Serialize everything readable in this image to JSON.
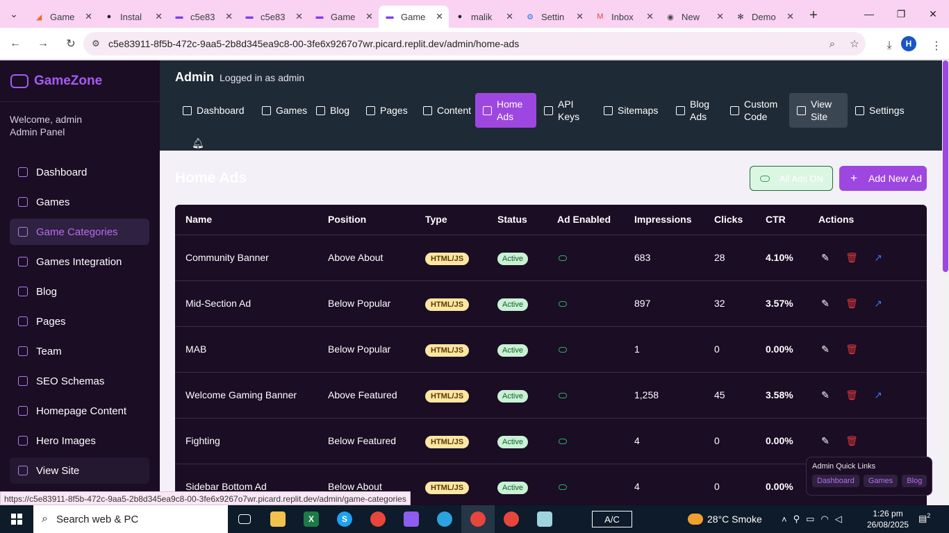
{
  "browser": {
    "tabs": [
      {
        "label": "Game",
        "icon": "orange"
      },
      {
        "label": "Instal",
        "icon": "github"
      },
      {
        "label": "c5e83",
        "icon": "gamepad"
      },
      {
        "label": "c5e83",
        "icon": "gamepad"
      },
      {
        "label": "Game",
        "icon": "gamepad"
      },
      {
        "label": "Game",
        "icon": "gamepad",
        "active": true
      },
      {
        "label": "malik",
        "icon": "github"
      },
      {
        "label": "Settin",
        "icon": "gear"
      },
      {
        "label": "Inbox",
        "icon": "gmail"
      },
      {
        "label": "New",
        "icon": "chrome"
      },
      {
        "label": "Demo",
        "icon": "openai"
      }
    ],
    "url": "c5e83911-8f5b-472c-9aa5-2b8d345ea9c8-00-3fe6x9267o7wr.picard.replit.dev/admin/home-ads",
    "profile_initial": "H",
    "status_url": "https://c5e83911-8f5b-472c-9aa5-2b8d345ea9c8-00-3fe6x9267o7wr.picard.replit.dev/admin/game-categories"
  },
  "sidebar": {
    "brand": "GameZone",
    "welcome": "Welcome, admin",
    "panel": "Admin Panel",
    "items": [
      {
        "label": "Dashboard"
      },
      {
        "label": "Games"
      },
      {
        "label": "Game Categories"
      },
      {
        "label": "Games Integration"
      },
      {
        "label": "Blog"
      },
      {
        "label": "Pages"
      },
      {
        "label": "Team"
      },
      {
        "label": "SEO Schemas"
      },
      {
        "label": "Homepage Content"
      },
      {
        "label": "Hero Images"
      },
      {
        "label": "View Site"
      }
    ]
  },
  "topbar": {
    "title": "Admin",
    "subtitle": "Logged in as admin",
    "tabs": [
      {
        "label": "Dashboard"
      },
      {
        "label": "Games"
      },
      {
        "label": "Blog"
      },
      {
        "label": "Pages"
      },
      {
        "label": "Content"
      },
      {
        "label": "Home Ads"
      },
      {
        "label": "API Keys"
      },
      {
        "label": "Sitemaps"
      },
      {
        "label": "Blog Ads"
      },
      {
        "label": "Custom Code"
      },
      {
        "label": "View Site"
      },
      {
        "label": "Settings"
      }
    ]
  },
  "page": {
    "title": "Home Ads",
    "all_ads_label": "All Ads ON",
    "add_label": "Add New Ad"
  },
  "table": {
    "headers": [
      "Name",
      "Position",
      "Type",
      "Status",
      "Ad Enabled",
      "Impressions",
      "Clicks",
      "CTR",
      "Actions"
    ],
    "rows": [
      {
        "name": "Community Banner",
        "position": "Above About",
        "type": "HTML/JS",
        "status": "Active",
        "impressions": "683",
        "clicks": "28",
        "ctr": "4.10%",
        "external": true
      },
      {
        "name": "Mid-Section Ad",
        "position": "Below Popular",
        "type": "HTML/JS",
        "status": "Active",
        "impressions": "897",
        "clicks": "32",
        "ctr": "3.57%",
        "external": true
      },
      {
        "name": "MAB",
        "position": "Below Popular",
        "type": "HTML/JS",
        "status": "Active",
        "impressions": "1",
        "clicks": "0",
        "ctr": "0.00%",
        "external": false
      },
      {
        "name": "Welcome Gaming Banner",
        "position": "Above Featured",
        "type": "HTML/JS",
        "status": "Active",
        "impressions": "1,258",
        "clicks": "45",
        "ctr": "3.58%",
        "external": true
      },
      {
        "name": "Fighting",
        "position": "Below Featured",
        "type": "HTML/JS",
        "status": "Active",
        "impressions": "4",
        "clicks": "0",
        "ctr": "0.00%",
        "external": false
      },
      {
        "name": "Sidebar Bottom Ad",
        "position": "Below About",
        "type": "HTML/JS",
        "status": "Active",
        "impressions": "4",
        "clicks": "0",
        "ctr": "0.00%",
        "external": false
      }
    ]
  },
  "quick_links": {
    "title": "Admin Quick Links",
    "links": [
      "Dashboard",
      "Games",
      "Blog"
    ]
  },
  "taskbar": {
    "search_placeholder": "Search web & PC",
    "ac_label": "A/C",
    "weather": "28°C  Smoke",
    "time": "1:26 pm",
    "date": "26/08/2025",
    "notifications": "2"
  },
  "colors": {
    "accent": "#9e47e0",
    "sidebar_bg": "#1a0d24",
    "topbar_bg": "#1e2a36",
    "delete": "#e03a3a",
    "external": "#3a78ff"
  }
}
